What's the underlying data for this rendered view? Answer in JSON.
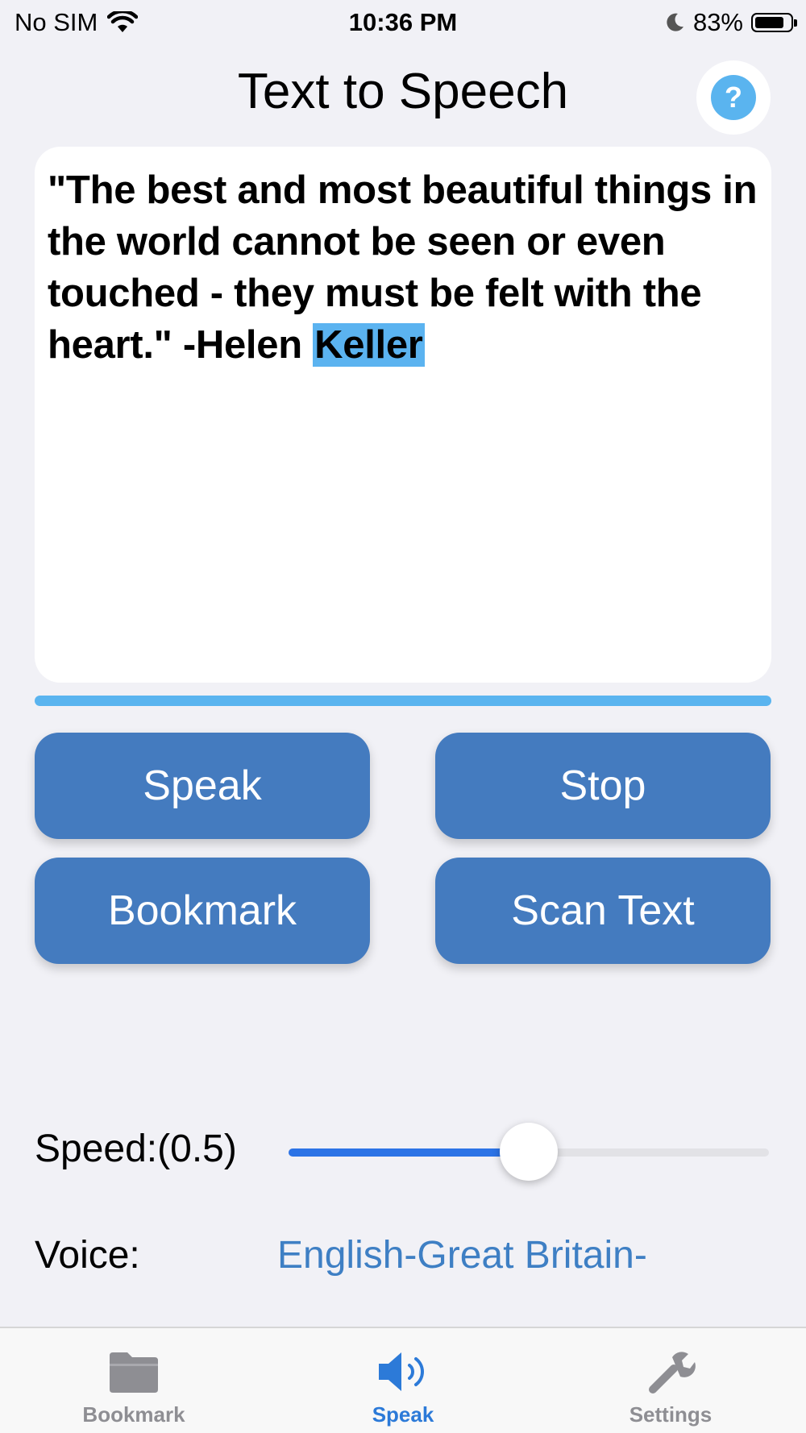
{
  "status_bar": {
    "carrier": "No SIM",
    "time": "10:36 PM",
    "battery": "83%",
    "battery_level": 0.83
  },
  "title": "Text to Speech",
  "help_label": "?",
  "text": {
    "before_highlight": "\"The best and most beautiful things in the world cannot be seen or even touched - they must be felt with the heart.\" -Helen ",
    "highlighted": "Keller"
  },
  "buttons": {
    "speak": "Speak",
    "stop": "Stop",
    "bookmark": "Bookmark",
    "scan_text": "Scan Text"
  },
  "speed": {
    "label": "Speed:(0.5)",
    "value": 0.5
  },
  "voice": {
    "label": "Voice:",
    "value": "English-Great Britain-"
  },
  "tabs": [
    {
      "label": "Bookmark",
      "icon": "folder-icon",
      "active": false
    },
    {
      "label": "Speak",
      "icon": "speaker-icon",
      "active": true
    },
    {
      "label": "Settings",
      "icon": "wrench-icon",
      "active": false
    }
  ],
  "colors": {
    "accent": "#447bbf",
    "highlight": "#5bb3f0",
    "tab_active": "#2c7ad8"
  }
}
